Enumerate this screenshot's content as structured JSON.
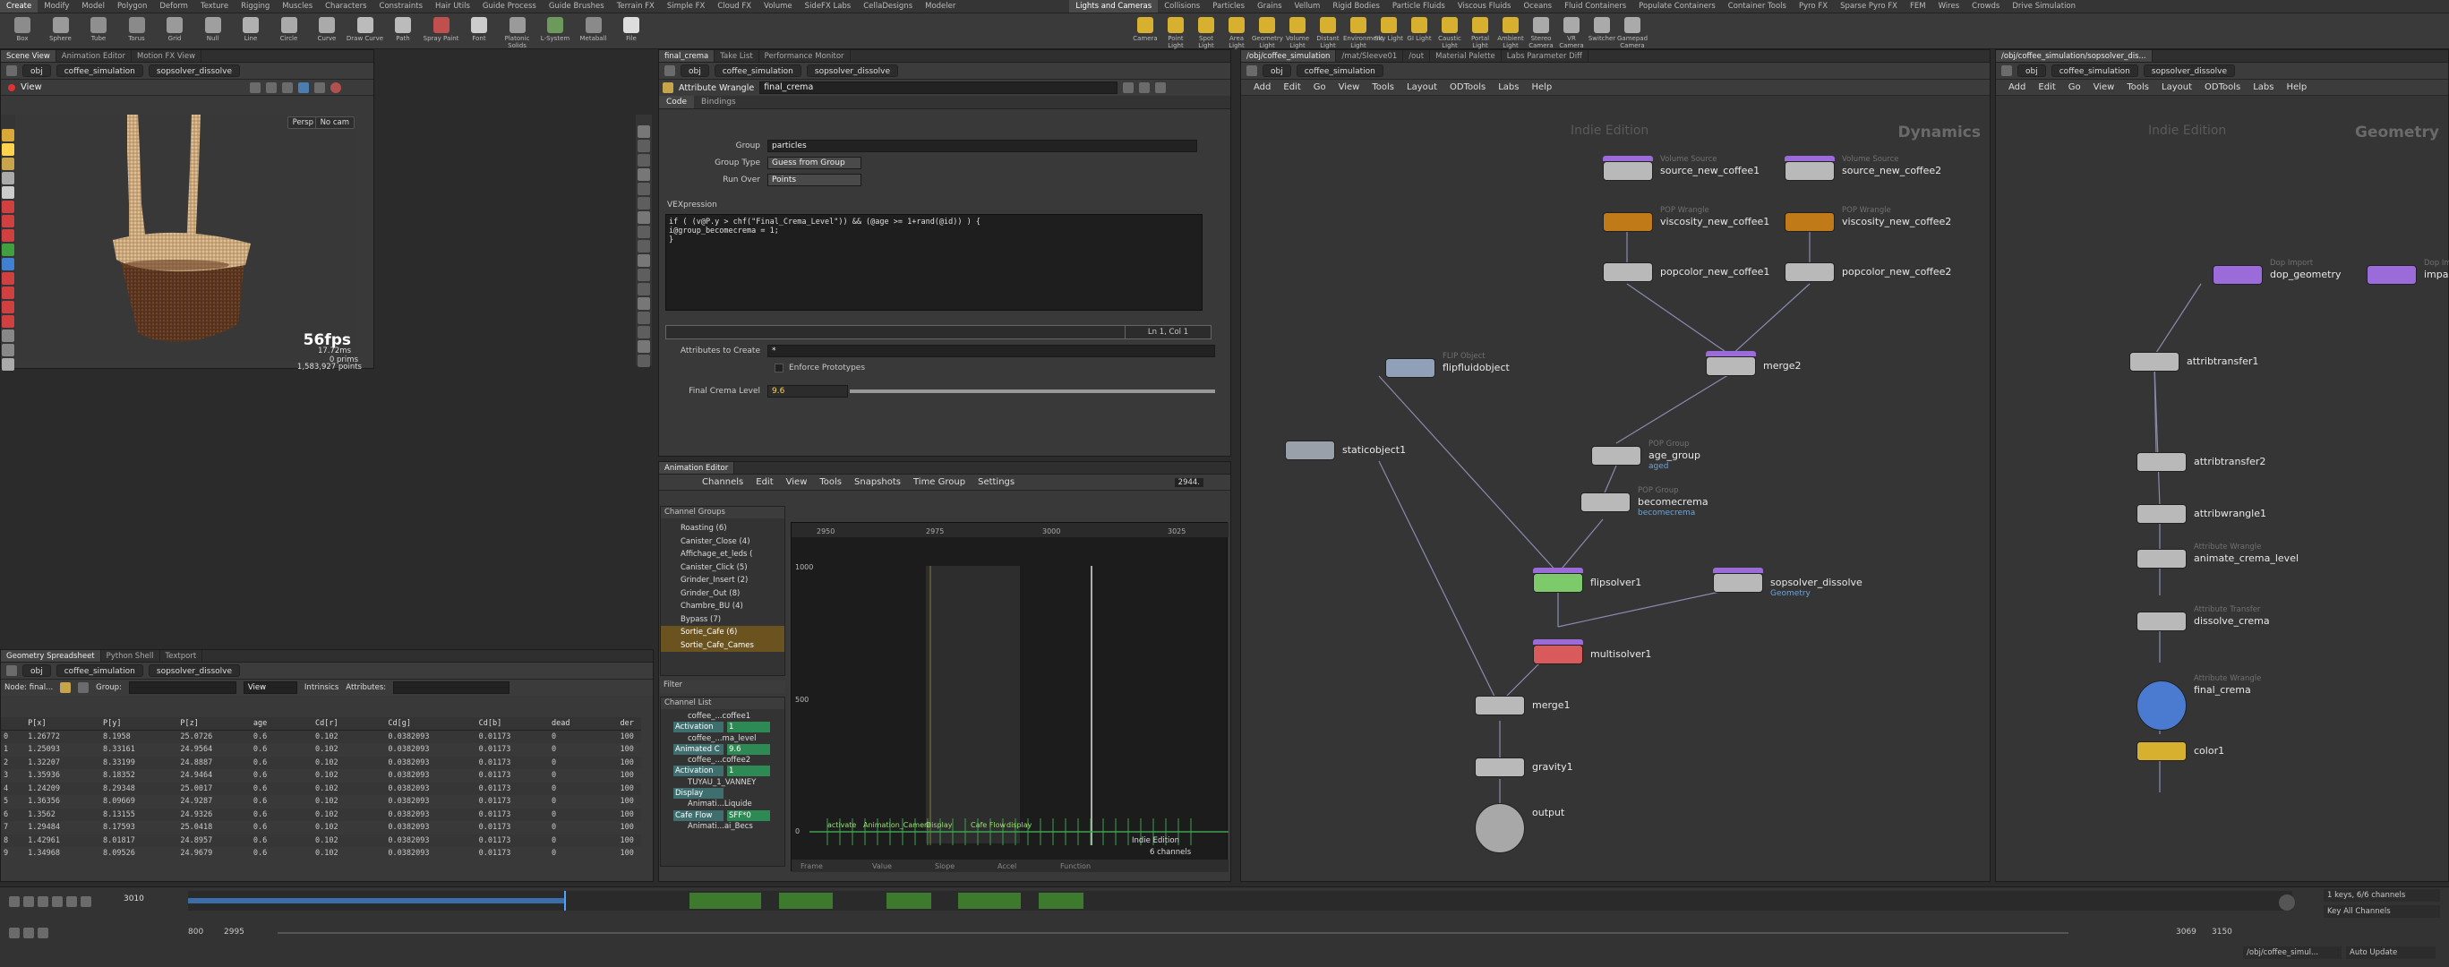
{
  "shelf": {
    "left_tabs": [
      "Create",
      "Modify",
      "Model",
      "Polygon",
      "Deform",
      "Texture",
      "Rigging",
      "Muscles",
      "Characters",
      "Constraints",
      "Hair Utils",
      "Guide Process",
      "Guide Brushes",
      "Terrain FX",
      "Simple FX",
      "Cloud FX",
      "Volume",
      "SideFX Labs",
      "CellaDesigns",
      "Modeler"
    ],
    "right_tabs": [
      "Lights and Cameras",
      "Collisions",
      "Particles",
      "Grains",
      "Vellum",
      "Rigid Bodies",
      "Particle Fluids",
      "Viscous Fluids",
      "Oceans",
      "Fluid Containers",
      "Populate Containers",
      "Container Tools",
      "Pyro FX",
      "Sparse Pyro FX",
      "FEM",
      "Wires",
      "Crowds",
      "Drive Simulation"
    ],
    "left_tools": [
      "Box",
      "Sphere",
      "Tube",
      "Torus",
      "Grid",
      "Null",
      "Line",
      "Circle",
      "Curve",
      "Draw Curve",
      "Path",
      "Spray Paint",
      "Font",
      "Platonic Solids",
      "L-System",
      "Metaball",
      "File"
    ],
    "right_tools": [
      "Camera",
      "Point Light",
      "Spot Light",
      "Area Light",
      "Geometry Light",
      "Volume Light",
      "Distant Light",
      "Environment Light",
      "Sky Light",
      "GI Light",
      "Caustic Light",
      "Portal Light",
      "Ambient Light",
      "Stereo Camera",
      "VR Camera",
      "Switcher",
      "Gamepad Camera"
    ]
  },
  "scene_pane": {
    "tabs": [
      "Scene View",
      "Animation Editor",
      "Motion FX View"
    ],
    "path": [
      "obj",
      "coffee_simulation",
      "sopsolver_dissolve"
    ],
    "view_label": "View",
    "persp": "Persp",
    "cam": "No cam",
    "fps": "56fps",
    "ms": "17.72ms",
    "prims": "0  prims",
    "points": "1,583,927 points"
  },
  "spreadsheet": {
    "tabs": [
      "Geometry Spreadsheet",
      "Python Shell",
      "Textport"
    ],
    "path": [
      "obj",
      "coffee_simulation",
      "sopsolver_dissolve"
    ],
    "node_label": "Node: final...",
    "group_label": "Group:",
    "view_label": "View",
    "intrinsics_label": "Intrinsics",
    "attributes_label": "Attributes:",
    "columns": [
      "",
      "P[x]",
      "P[y]",
      "P[z]",
      "age",
      "Cd[r]",
      "Cd[g]",
      "Cd[b]",
      "dead",
      "der"
    ],
    "rows": [
      [
        "0",
        "1.26772",
        "8.1958",
        "25.0726",
        "0.6",
        "0.102",
        "0.0382093",
        "0.01173",
        "0",
        "100"
      ],
      [
        "1",
        "1.25093",
        "8.33161",
        "24.9564",
        "0.6",
        "0.102",
        "0.0382093",
        "0.01173",
        "0",
        "100"
      ],
      [
        "2",
        "1.32207",
        "8.33199",
        "24.8887",
        "0.6",
        "0.102",
        "0.0382093",
        "0.01173",
        "0",
        "100"
      ],
      [
        "3",
        "1.35936",
        "8.18352",
        "24.9464",
        "0.6",
        "0.102",
        "0.0382093",
        "0.01173",
        "0",
        "100"
      ],
      [
        "4",
        "1.24209",
        "8.29348",
        "25.0017",
        "0.6",
        "0.102",
        "0.0382093",
        "0.01173",
        "0",
        "100"
      ],
      [
        "5",
        "1.36356",
        "8.09669",
        "24.9287",
        "0.6",
        "0.102",
        "0.0382093",
        "0.01173",
        "0",
        "100"
      ],
      [
        "6",
        "1.3562",
        "8.13155",
        "24.9326",
        "0.6",
        "0.102",
        "0.0382093",
        "0.01173",
        "0",
        "100"
      ],
      [
        "7",
        "1.29484",
        "8.17593",
        "25.0418",
        "0.6",
        "0.102",
        "0.0382093",
        "0.01173",
        "0",
        "100"
      ],
      [
        "8",
        "1.42961",
        "8.01817",
        "24.8957",
        "0.6",
        "0.102",
        "0.0382093",
        "0.01173",
        "0",
        "100"
      ],
      [
        "9",
        "1.34968",
        "8.09526",
        "24.9679",
        "0.6",
        "0.102",
        "0.0382093",
        "0.01173",
        "0",
        "100"
      ]
    ]
  },
  "parm_pane": {
    "tabs": [
      "final_crema",
      "Take List",
      "Performance Monitor"
    ],
    "path": [
      "obj",
      "coffee_simulation",
      "sopsolver_dissolve"
    ],
    "node_type": "Attribute Wrangle",
    "node_name": "final_crema",
    "sub_tabs": [
      "Code",
      "Bindings"
    ],
    "group_label": "Group",
    "group_value": "particles",
    "group_type_label": "Group Type",
    "group_type_value": "Guess from Group",
    "run_over_label": "Run Over",
    "run_over_value": "Points",
    "vex_label": "VEXpression",
    "vex_line1": "if ( (v@P.y > chf(\"Final_Crema_Level\")) && (@age >= 1+rand(@id)) ) {",
    "vex_line2": "    i@group_becomecrema = 1;",
    "vex_line3": "}",
    "cursor_pos": "Ln 1, Col 1",
    "attr_create_label": "Attributes to Create",
    "attr_create_value": "*",
    "enforce_label": "Enforce Prototypes",
    "crema_label": "Final Crema Level",
    "crema_value": "9.6"
  },
  "anim_editor": {
    "tabs": [
      "Animation Editor"
    ],
    "menu": [
      "Channels",
      "Edit",
      "View",
      "Tools",
      "Snapshots",
      "Time Group",
      "Settings"
    ],
    "frame_field": "2944.",
    "channel_groups_label": "Channel Groups",
    "groups": [
      "Roasting (6)",
      "Canister_Close (4)",
      "Affichage_et_leds (",
      "Canister_Click (5)",
      "Grinder_Insert (2)",
      "Grinder_Out (8)",
      "Chambre_BU (4)",
      "Bypass (7)",
      "Sortie_Cafe (6)",
      "Sortie_Cafe_Cames"
    ],
    "filter_label": "Filter",
    "channel_list_label": "Channel List",
    "channels": [
      {
        "name": "coffee_...coffee1",
        "kind": "node"
      },
      {
        "name": "Activation",
        "value": "1",
        "kind": "param"
      },
      {
        "name": "coffee_...ma_level",
        "kind": "node"
      },
      {
        "name": "Animated C",
        "value": "9.6",
        "kind": "param"
      },
      {
        "name": "coffee_...coffee2",
        "kind": "node"
      },
      {
        "name": "Activation",
        "value": "1",
        "kind": "param"
      },
      {
        "name": "TUYAU_1_VANNEY",
        "kind": "node"
      },
      {
        "name": "Display",
        "value": "",
        "kind": "param"
      },
      {
        "name": "Animati...Liquide",
        "kind": "node"
      },
      {
        "name": "Cafe Flow",
        "value": "SFF*0",
        "kind": "param"
      },
      {
        "name": "Animati...ai_Becs",
        "kind": "node"
      }
    ],
    "ruler": [
      "2950",
      "2975",
      "3000",
      "3025"
    ],
    "y_labels": [
      "1000",
      "500",
      "0"
    ],
    "graph_labels": [
      "activate",
      "Animation_Camera",
      "Display",
      "Cafe Flow",
      "display"
    ],
    "edition": "Indie Edition",
    "channels_count": "6 channels",
    "footer": [
      "Frame",
      "Value",
      "Slope",
      "Accel",
      "Function"
    ]
  },
  "dynamics_pane": {
    "tabs": [
      "/obj/coffee_simulation",
      "/mat/Sleeve01",
      "/out",
      "Material Palette",
      "Labs Parameter Diff"
    ],
    "path": [
      "obj",
      "coffee_simulation"
    ],
    "menu": [
      "Add",
      "Edit",
      "Go",
      "View",
      "Tools",
      "Layout",
      "ODTools",
      "Labs",
      "Help"
    ],
    "edition": "Indie Edition",
    "context": "Dynamics",
    "nodes": {
      "source1": {
        "type": "Volume Source",
        "name": "source_new_coffee1"
      },
      "source2": {
        "type": "Volume Source",
        "name": "source_new_coffee2"
      },
      "visc1": {
        "type": "POP Wrangle",
        "name": "viscosity_new_coffee1"
      },
      "visc2": {
        "type": "POP Wrangle",
        "name": "viscosity_new_coffee2"
      },
      "pcol1": {
        "name": "popcolor_new_coffee1"
      },
      "pcol2": {
        "name": "popcolor_new_coffee2"
      },
      "merge2": {
        "name": "merge2"
      },
      "flipobj": {
        "type": "FLIP Object",
        "name": "flipfluidobject"
      },
      "static": {
        "name": "staticobject1"
      },
      "agegroup": {
        "type": "POP Group",
        "name": "age_group",
        "sub": "aged"
      },
      "becomecrema": {
        "type": "POP Group",
        "name": "becomecrema",
        "sub": "becomecrema"
      },
      "flipsolver": {
        "name": "flipsolver1"
      },
      "sopsolver": {
        "name": "sopsolver_dissolve",
        "sub": "Geometry"
      },
      "multisolver": {
        "name": "multisolver1"
      },
      "merge1": {
        "name": "merge1"
      },
      "gravity": {
        "name": "gravity1"
      },
      "output": {
        "name": "output"
      }
    }
  },
  "geometry_pane": {
    "tabs": [
      "/obj/coffee_simulation/sopsolver_dis..."
    ],
    "path": [
      "obj",
      "coffee_simulation",
      "sopsolver_dissolve"
    ],
    "menu": [
      "Add",
      "Edit",
      "Go",
      "View",
      "Tools",
      "Layout",
      "ODTools",
      "Labs",
      "Help"
    ],
    "edition": "Indie Edition",
    "context": "Geometry",
    "nodes": {
      "dopgeo": {
        "type": "Dop Import",
        "name": "dop_geometry"
      },
      "impacts": {
        "type": "Dop Import",
        "name": "impacts"
      },
      "at1": {
        "name": "attribtransfer1"
      },
      "at2": {
        "name": "attribtransfer2"
      },
      "aw1": {
        "name": "attribwrangle1"
      },
      "acl": {
        "type": "Attribute Wrangle",
        "name": "animate_crema_level"
      },
      "dc": {
        "type": "Attribute Transfer",
        "name": "dissolve_crema"
      },
      "fc": {
        "type": "Attribute Wrangle",
        "name": "final_crema"
      },
      "color": {
        "name": "color1"
      }
    }
  },
  "timeline": {
    "frame": "3010",
    "start": "800",
    "end_field": "2995",
    "range_start": "3069",
    "range_end": "3150",
    "keys_label": "1 keys, 6/6 channels",
    "key_all": "Key All Channels",
    "path": "/obj/coffee_simul...",
    "auto_update": "Auto Update"
  },
  "colors": {
    "accent": "#f0a020",
    "crema_green": "#4caf50",
    "purple": "#9b6bd9"
  }
}
